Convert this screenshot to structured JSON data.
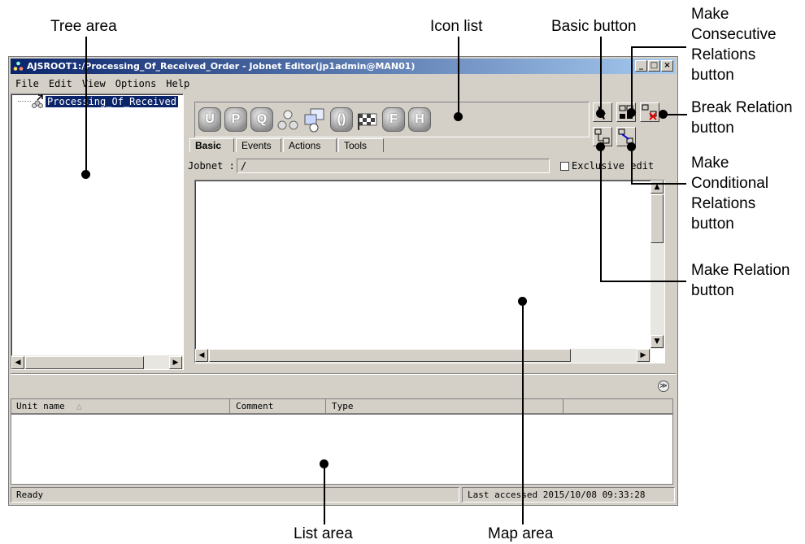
{
  "window": {
    "title": "AJSROOT1:/Processing_Of_Received_Order - Jobnet Editor(jp1admin@MAN01)",
    "controls": {
      "minimize": "_",
      "maximize": "□",
      "close": "×"
    }
  },
  "menu": [
    "File",
    "Edit",
    "View",
    "Options",
    "Help"
  ],
  "tree": {
    "selected_item": "Processing_Of_Received"
  },
  "icon_list": {
    "icons": [
      {
        "name": "u-unit",
        "glyph": "U"
      },
      {
        "name": "p-unit",
        "glyph": "P"
      },
      {
        "name": "q-unit",
        "glyph": "Q"
      },
      {
        "name": "jobnet-connector",
        "glyph": ""
      },
      {
        "name": "command-job",
        "glyph": ""
      },
      {
        "name": "judgment-job",
        "glyph": "()"
      },
      {
        "name": "flag-job",
        "glyph": ""
      },
      {
        "name": "file-transfer",
        "glyph": "F"
      },
      {
        "name": "http-job",
        "glyph": "H"
      }
    ]
  },
  "tabs": [
    "Basic",
    "Events",
    "Actions",
    "Tools"
  ],
  "jobnet": {
    "label": "Jobnet :",
    "value": "/"
  },
  "exclusive_edit": {
    "label": "Exclusive edit",
    "checked": false
  },
  "list": {
    "columns": [
      "Unit name",
      "Comment",
      "Type"
    ],
    "sort_indicator": "△",
    "expand_glyph": "≫"
  },
  "status": {
    "left": "Ready",
    "right": "Last accessed 2015/10/08 09:33:28"
  },
  "callouts": {
    "tree_area": "Tree area",
    "icon_list": "Icon list",
    "basic_button": "Basic button",
    "consecutive": [
      "Make",
      "Consecutive",
      "Relations",
      "button"
    ],
    "break_relation": [
      "Break Relation",
      "button"
    ],
    "conditional": [
      "Make",
      "Conditional",
      "Relations",
      "button"
    ],
    "make_relation": [
      "Make Relation",
      "button"
    ],
    "list_area": "List area",
    "map_area": "Map area"
  }
}
